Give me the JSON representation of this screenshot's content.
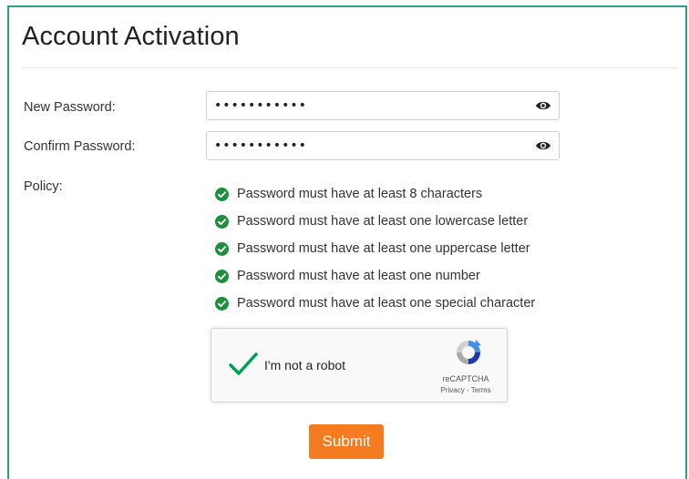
{
  "page": {
    "title": "Account Activation"
  },
  "form": {
    "new_password": {
      "label": "New Password:",
      "value": "•••••••••••",
      "icon": "eye-icon"
    },
    "confirm_password": {
      "label": "Confirm Password:",
      "value": "•••••••••••",
      "icon": "eye-icon"
    },
    "policy": {
      "label": "Policy:",
      "items": [
        {
          "text": "Password must have at least 8 characters",
          "status": "met"
        },
        {
          "text": "Password must have at least one lowercase letter",
          "status": "met"
        },
        {
          "text": "Password must have at least one uppercase letter",
          "status": "met"
        },
        {
          "text": "Password must have at least one number",
          "status": "met"
        },
        {
          "text": "Password must have at least one special character",
          "status": "met"
        }
      ]
    }
  },
  "recaptcha": {
    "label": "I'm not a robot",
    "checked": true,
    "brand": "reCAPTCHA",
    "privacy": "Privacy",
    "separator": " - ",
    "terms": "Terms"
  },
  "submit": {
    "label": "Submit"
  },
  "colors": {
    "border_accent": "#2f9e8f",
    "check_green": "#1e8e3e",
    "submit_bg": "#f47b20",
    "recaptcha_check": "#009e55"
  }
}
